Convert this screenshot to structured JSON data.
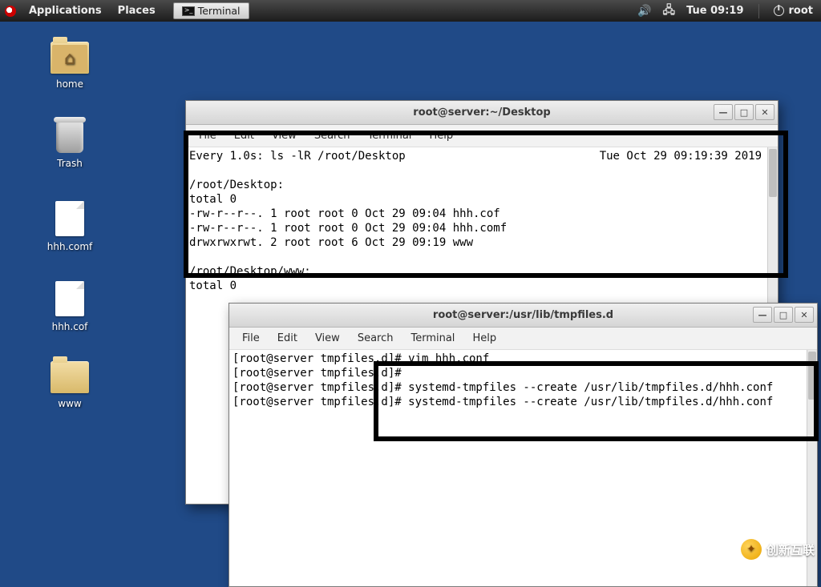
{
  "panel": {
    "applications": "Applications",
    "places": "Places",
    "taskbar_terminal": "Terminal",
    "clock": "Tue 09:19",
    "user": "root"
  },
  "desktop": {
    "home": "home",
    "trash": "Trash",
    "file_comf": "hhh.comf",
    "file_cof": "hhh.cof",
    "folder_www": "www"
  },
  "menu": {
    "file": "File",
    "edit": "Edit",
    "view": "View",
    "search": "Search",
    "terminal": "Terminal",
    "help": "Help"
  },
  "win_btn": {
    "min": "—",
    "max": "□",
    "close": "✕"
  },
  "window1": {
    "title": "root@server:~/Desktop",
    "watch_left": "Every 1.0s: ls -lR /root/Desktop",
    "watch_right": "Tue Oct 29 09:19:39 2019",
    "dir1": "/root/Desktop:",
    "total1": "total 0",
    "line1": "-rw-r--r--. 1 root root 0 Oct 29 09:04 hhh.cof",
    "line2": "-rw-r--r--. 1 root root 0 Oct 29 09:04 hhh.comf",
    "line3": "drwxrwxrwt. 2 root root 6 Oct 29 09:19 www",
    "dir2": "/root/Desktop/www:",
    "total2": "total 0"
  },
  "window2": {
    "title": "root@server:/usr/lib/tmpfiles.d",
    "l1": "[root@server tmpfiles.d]# vim hhh.conf",
    "l2": "[root@server tmpfiles.d]#",
    "l3": "[root@server tmpfiles.d]# systemd-tmpfiles --create /usr/lib/tmpfiles.d/hhh.conf",
    "l4": "[root@server tmpfiles.d]# systemd-tmpfiles --create /usr/lib/tmpfiles.d/hhh.conf"
  },
  "watermark": "创新互联"
}
